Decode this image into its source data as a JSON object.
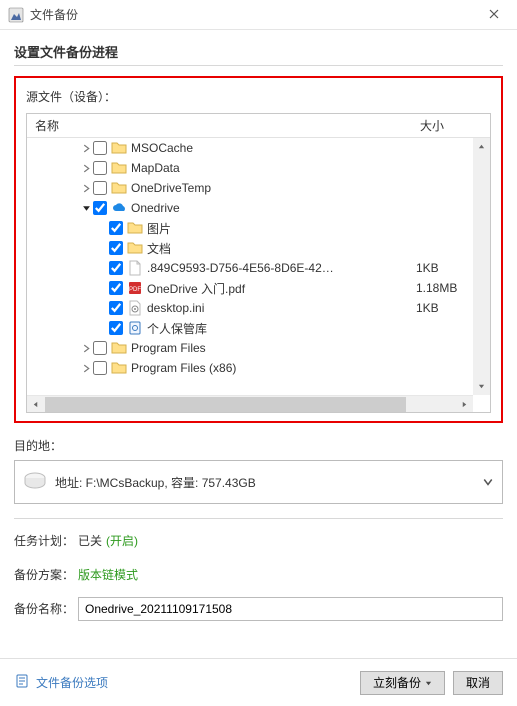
{
  "window": {
    "title": "文件备份"
  },
  "section_title": "设置文件备份进程",
  "source_label": "源文件（设备）：",
  "tree": {
    "cols": {
      "name": "名称",
      "size": "大小"
    },
    "rows": [
      {
        "indent": 3,
        "arrow": "right",
        "checked": false,
        "icon": "folder",
        "label": "MSOCache",
        "size": ""
      },
      {
        "indent": 3,
        "arrow": "right",
        "checked": false,
        "icon": "folder",
        "label": "MapData",
        "size": ""
      },
      {
        "indent": 3,
        "arrow": "right",
        "checked": false,
        "icon": "folder",
        "label": "OneDriveTemp",
        "size": ""
      },
      {
        "indent": 3,
        "arrow": "down",
        "checked": true,
        "icon": "onedrive",
        "label": "Onedrive",
        "size": ""
      },
      {
        "indent": 4,
        "arrow": "none",
        "checked": true,
        "icon": "folder",
        "label": "图片",
        "size": ""
      },
      {
        "indent": 4,
        "arrow": "none",
        "checked": true,
        "icon": "folder",
        "label": "文档",
        "size": ""
      },
      {
        "indent": 4,
        "arrow": "none",
        "checked": true,
        "icon": "file",
        "label": ".849C9593-D756-4E56-8D6E-42…",
        "size": "1KB"
      },
      {
        "indent": 4,
        "arrow": "none",
        "checked": true,
        "icon": "pdf",
        "label": "OneDrive 入门.pdf",
        "size": "1.18MB"
      },
      {
        "indent": 4,
        "arrow": "none",
        "checked": true,
        "icon": "ini",
        "label": "desktop.ini",
        "size": "1KB"
      },
      {
        "indent": 4,
        "arrow": "none",
        "checked": true,
        "icon": "vault",
        "label": "个人保管库",
        "size": ""
      },
      {
        "indent": 3,
        "arrow": "right",
        "checked": false,
        "icon": "folder",
        "label": "Program Files",
        "size": ""
      },
      {
        "indent": 3,
        "arrow": "right",
        "checked": false,
        "icon": "folder",
        "label": "Program Files (x86)",
        "size": ""
      }
    ]
  },
  "dest": {
    "label": "目的地：",
    "text": "地址: F:\\MCsBackup, 容量: 757.43GB"
  },
  "schedule": {
    "label": "任务计划：",
    "status": "已关",
    "enable": "(开启)"
  },
  "scheme": {
    "label": "备份方案：",
    "mode": "版本链模式"
  },
  "name": {
    "label": "备份名称：",
    "value": "Onedrive_20211109171508"
  },
  "footer": {
    "options": "文件备份选项",
    "ok": "立刻备份",
    "cancel": "取消"
  }
}
